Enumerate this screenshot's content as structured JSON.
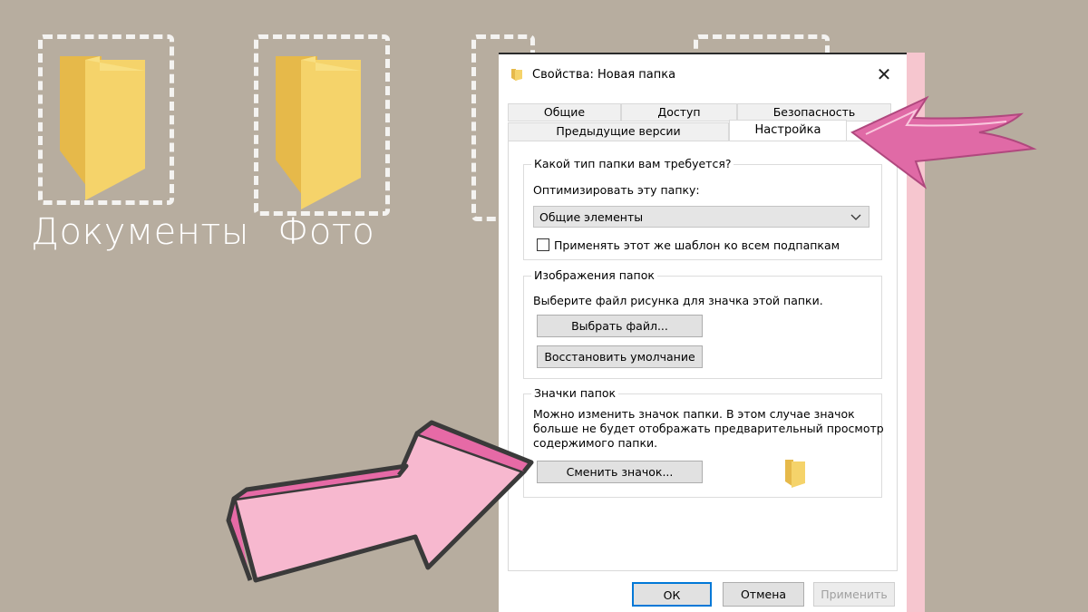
{
  "desktop": {
    "icons": [
      {
        "label": "Документы"
      },
      {
        "label": "Фото"
      },
      {
        "label": ""
      },
      {
        "label": ""
      }
    ],
    "folder_color": "#f2c94c"
  },
  "dialog": {
    "title": "Свойства: Новая папка",
    "close_label": "✕",
    "tabs_row1": [
      "Общие",
      "Доступ",
      "Безопасность"
    ],
    "tabs_row2": [
      "Предыдущие версии",
      "Настройка"
    ],
    "active_tab": "Настройка",
    "folder_type": {
      "group_title": "Какой тип папки вам требуется?",
      "optimize_label": "Оптимизировать эту папку:",
      "selected_value": "Общие элементы",
      "apply_subfolders_label": "Применять этот же шаблон ко всем подпапкам",
      "apply_subfolders_checked": false
    },
    "folder_pictures": {
      "group_title": "Изображения папок",
      "description": "Выберите файл рисунка для значка этой папки.",
      "choose_file_button": "Выбрать файл...",
      "restore_default_button": "Восстановить умолчание"
    },
    "folder_icons": {
      "group_title": "Значки папок",
      "description_lines": [
        "Можно изменить значок папки. В этом случае значок",
        "больше не будет отображать предварительный просмотр",
        "содержимого папки."
      ],
      "change_icon_button": "Сменить значок..."
    },
    "buttons": {
      "ok": "ОК",
      "cancel": "Отмена",
      "apply": "Применить"
    }
  },
  "accent_pink": "#e66aa6",
  "arrow_fill": "#f7b8cf"
}
